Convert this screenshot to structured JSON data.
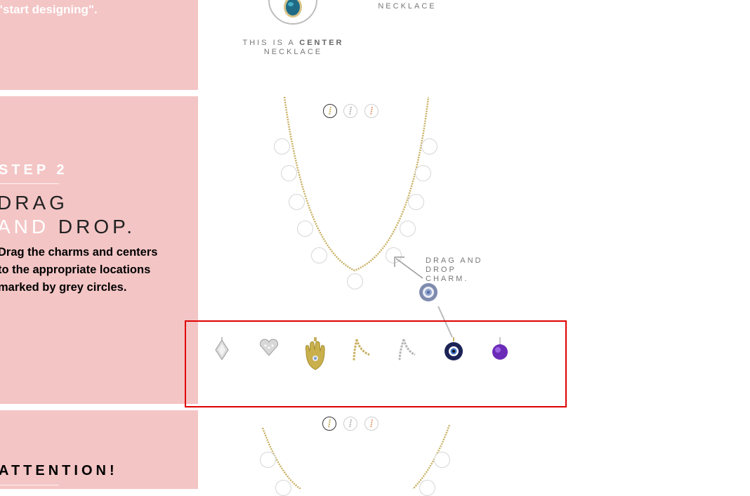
{
  "step1": {
    "text": "\"start designing\"."
  },
  "center_necklace": {
    "caption_prefix": "THIS IS A ",
    "caption_bold": "CENTER",
    "caption_line2": "NECKLACE",
    "right_caption": "NECKLACE"
  },
  "step2": {
    "label": "STEP 2",
    "title_line1": "DRAG",
    "title_line2_a": "AND",
    "title_line2_b": "DROP.",
    "description": "Drag the charms and centers to the appropriate locations marked by grey circles."
  },
  "metal_options": [
    "gold",
    "silver",
    "rose-gold"
  ],
  "hint": {
    "line1": "DRAG AND",
    "line2": "DROP CHARM."
  },
  "charms": [
    {
      "name": "diamond-charm",
      "icon": "pave-diamond-shape"
    },
    {
      "name": "heart-charm",
      "icon": "pave-heart"
    },
    {
      "name": "hamsa-charm",
      "icon": "gold-hamsa"
    },
    {
      "name": "wishbone-gold-charm",
      "icon": "gold-wishbone"
    },
    {
      "name": "wishbone-silver-charm",
      "icon": "silver-wishbone"
    },
    {
      "name": "evil-eye-charm",
      "icon": "blue-evil-eye"
    },
    {
      "name": "amethyst-charm",
      "icon": "purple-gem"
    }
  ],
  "attention": {
    "label": "ATTENTION!"
  },
  "colors": {
    "panel": "#f4c5c5",
    "highlight": "#e00000"
  }
}
